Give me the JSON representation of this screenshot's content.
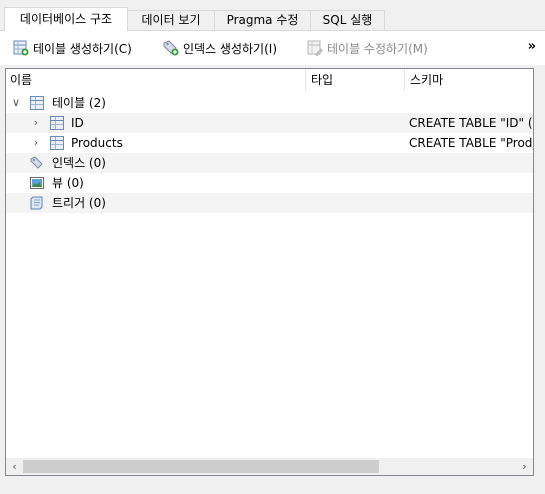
{
  "tabs": [
    {
      "label": "데이터베이스 구조",
      "active": true
    },
    {
      "label": "데이터 보기",
      "active": false
    },
    {
      "label": "Pragma 수정",
      "active": false
    },
    {
      "label": "SQL 실행",
      "active": false
    }
  ],
  "toolbar": {
    "create_table": "테이블 생성하기(C)",
    "create_index": "인덱스 생성하기(I)",
    "modify_table": "테이블 수정하기(M)",
    "overflow": "»"
  },
  "tree": {
    "columns": {
      "name": "이름",
      "type": "타입",
      "schema": "스키마"
    },
    "tables_group": "테이블 (2)",
    "tables": [
      {
        "name": "ID",
        "schema": "CREATE TABLE \"ID\" ( \"I"
      },
      {
        "name": "Products",
        "schema": "CREATE TABLE \"Produc"
      }
    ],
    "indexes_group": "인덱스 (0)",
    "views_group": "뷰 (0)",
    "triggers_group": "트리거 (0)"
  },
  "icons": {
    "expand": "chevron-right",
    "collapse": "chevron-down"
  }
}
